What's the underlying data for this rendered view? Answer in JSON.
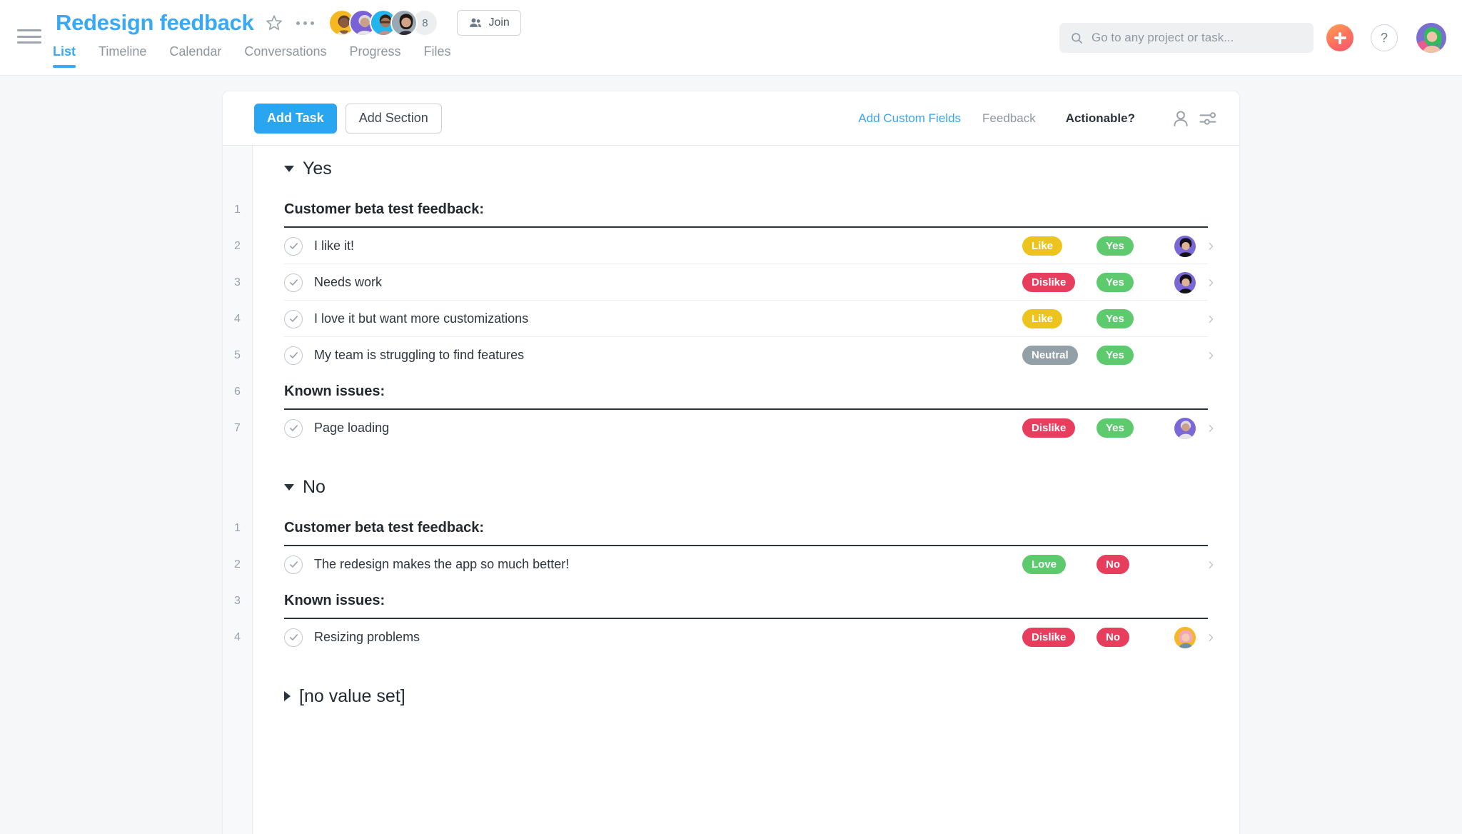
{
  "header": {
    "menu_icon": "hamburger-icon",
    "project_title": "Redesign feedback",
    "star_icon": "star-icon",
    "more_icon": "ellipsis-icon",
    "member_overflow_count": "8",
    "join_label": "Join",
    "join_icon": "people-icon",
    "tabs": [
      {
        "label": "List",
        "active": true
      },
      {
        "label": "Timeline",
        "active": false
      },
      {
        "label": "Calendar",
        "active": false
      },
      {
        "label": "Conversations",
        "active": false
      },
      {
        "label": "Progress",
        "active": false
      },
      {
        "label": "Files",
        "active": false
      }
    ],
    "search": {
      "placeholder": "Go to any project or task...",
      "icon": "search-icon",
      "value": ""
    },
    "plus_icon": "plus-icon",
    "help_label": "?",
    "avatar": "user-avatar"
  },
  "toolbar": {
    "add_task_label": "Add Task",
    "add_section_label": "Add Section",
    "add_custom_fields_label": "Add Custom Fields",
    "column_feedback_label": "Feedback",
    "column_actionable_label": "Actionable?",
    "assignee_icon": "person-icon",
    "filter_icon": "sliders-icon"
  },
  "colors": {
    "accent_blue": "#2aa6f0",
    "like_yellow": "#edc31e",
    "dislike_red": "#e83e5e",
    "neutral_gray": "#93a0a8",
    "yes_green": "#5dcb6d",
    "love_green": "#5dcb6d",
    "no_red": "#e83e5e"
  },
  "sections": [
    {
      "title": "Yes",
      "expanded": true,
      "caret": "caret-down-icon",
      "rows": [
        {
          "num": "1",
          "type": "subhead",
          "label": "Customer beta test feedback:"
        },
        {
          "num": "2",
          "type": "task",
          "label": "I like it!",
          "feedback": "Like",
          "feedback_color": "#edc31e",
          "actionable": "Yes",
          "actionable_color": "#5dcb6d",
          "avatar": "avatar-purple-1"
        },
        {
          "num": "3",
          "type": "task",
          "label": "Needs work",
          "feedback": "Dislike",
          "feedback_color": "#e83e5e",
          "actionable": "Yes",
          "actionable_color": "#5dcb6d",
          "avatar": "avatar-purple-1"
        },
        {
          "num": "4",
          "type": "task",
          "label": "I love it but want more customizations",
          "feedback": "Like",
          "feedback_color": "#edc31e",
          "actionable": "Yes",
          "actionable_color": "#5dcb6d",
          "avatar": ""
        },
        {
          "num": "5",
          "type": "task",
          "label": "My team is struggling to find features",
          "feedback": "Neutral",
          "feedback_color": "#93a0a8",
          "actionable": "Yes",
          "actionable_color": "#5dcb6d",
          "avatar": ""
        },
        {
          "num": "6",
          "type": "subhead",
          "label": "Known issues:"
        },
        {
          "num": "7",
          "type": "task",
          "label": "Page loading",
          "feedback": "Dislike",
          "feedback_color": "#e83e5e",
          "actionable": "Yes",
          "actionable_color": "#5dcb6d",
          "avatar": "avatar-purple-2"
        }
      ]
    },
    {
      "title": "No",
      "expanded": true,
      "caret": "caret-down-icon",
      "rows": [
        {
          "num": "1",
          "type": "subhead",
          "label": "Customer beta test feedback:"
        },
        {
          "num": "2",
          "type": "task",
          "label": "The redesign makes the app so much better!",
          "feedback": "Love",
          "feedback_color": "#5dcb6d",
          "actionable": "No",
          "actionable_color": "#e83e5e",
          "avatar": ""
        },
        {
          "num": "3",
          "type": "subhead",
          "label": "Known issues:"
        },
        {
          "num": "4",
          "type": "task",
          "label": "Resizing problems",
          "feedback": "Dislike",
          "feedback_color": "#e83e5e",
          "actionable": "No",
          "actionable_color": "#e83e5e",
          "avatar": "avatar-gold"
        }
      ]
    },
    {
      "title": "[no value set]",
      "expanded": false,
      "caret": "caret-right-icon",
      "rows": []
    }
  ]
}
